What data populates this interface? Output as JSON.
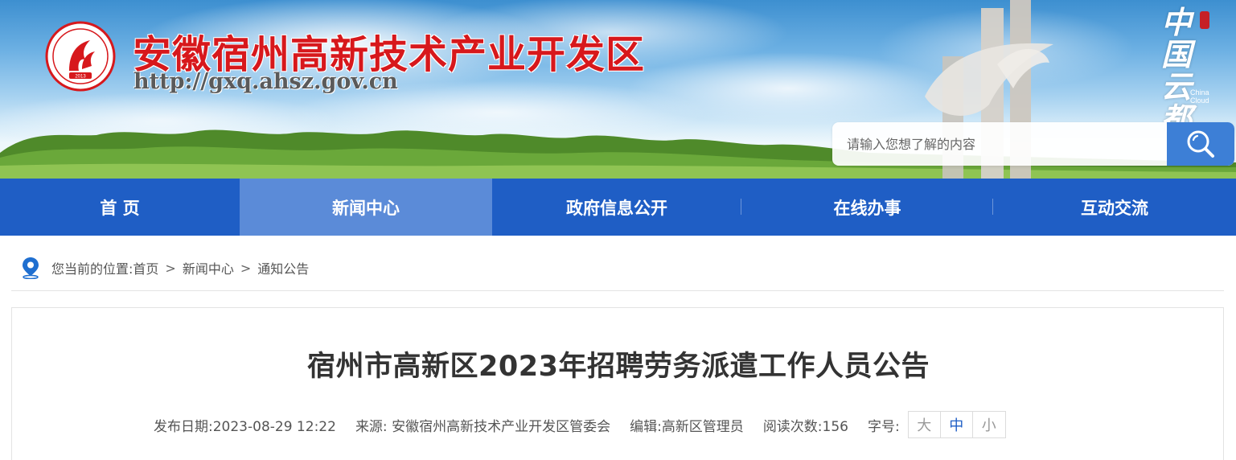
{
  "header": {
    "site_name": "安徽宿州高新技术产业开发区",
    "site_url": "http://gxq.ahsz.gov.cn",
    "emblem_year": "2013",
    "brand_text": "中国云都",
    "brand_en": "China Cloud C",
    "search": {
      "placeholder": "请输入您想了解的内容"
    }
  },
  "nav": {
    "items": [
      {
        "label": "首 页",
        "active": false
      },
      {
        "label": "新闻中心",
        "active": true
      },
      {
        "label": "政府信息公开",
        "active": false
      },
      {
        "label": "在线办事",
        "active": false
      },
      {
        "label": "互动交流",
        "active": false
      }
    ]
  },
  "breadcrumb": {
    "prefix": "您当前的位置:",
    "items": [
      "首页",
      "新闻中心",
      "通知公告"
    ],
    "separator": ">"
  },
  "article": {
    "title": "宿州市高新区2023年招聘劳务派遣工作人员公告",
    "meta": {
      "date_label": "发布日期:",
      "date": "2023-08-29 12:22",
      "source_label": "来源:",
      "source": "安徽宿州高新技术产业开发区管委会",
      "editor_label": "编辑:",
      "editor": "高新区管理员",
      "views_label": "阅读次数:",
      "views": "156",
      "font_label": "字号:",
      "font_sizes": [
        "大",
        "中",
        "小"
      ],
      "active_font": "中"
    }
  },
  "colors": {
    "nav_bg": "#1f5ec5",
    "nav_active": "#5b8bd8",
    "site_name": "#d7181c",
    "search_button": "#3d7fd6"
  }
}
